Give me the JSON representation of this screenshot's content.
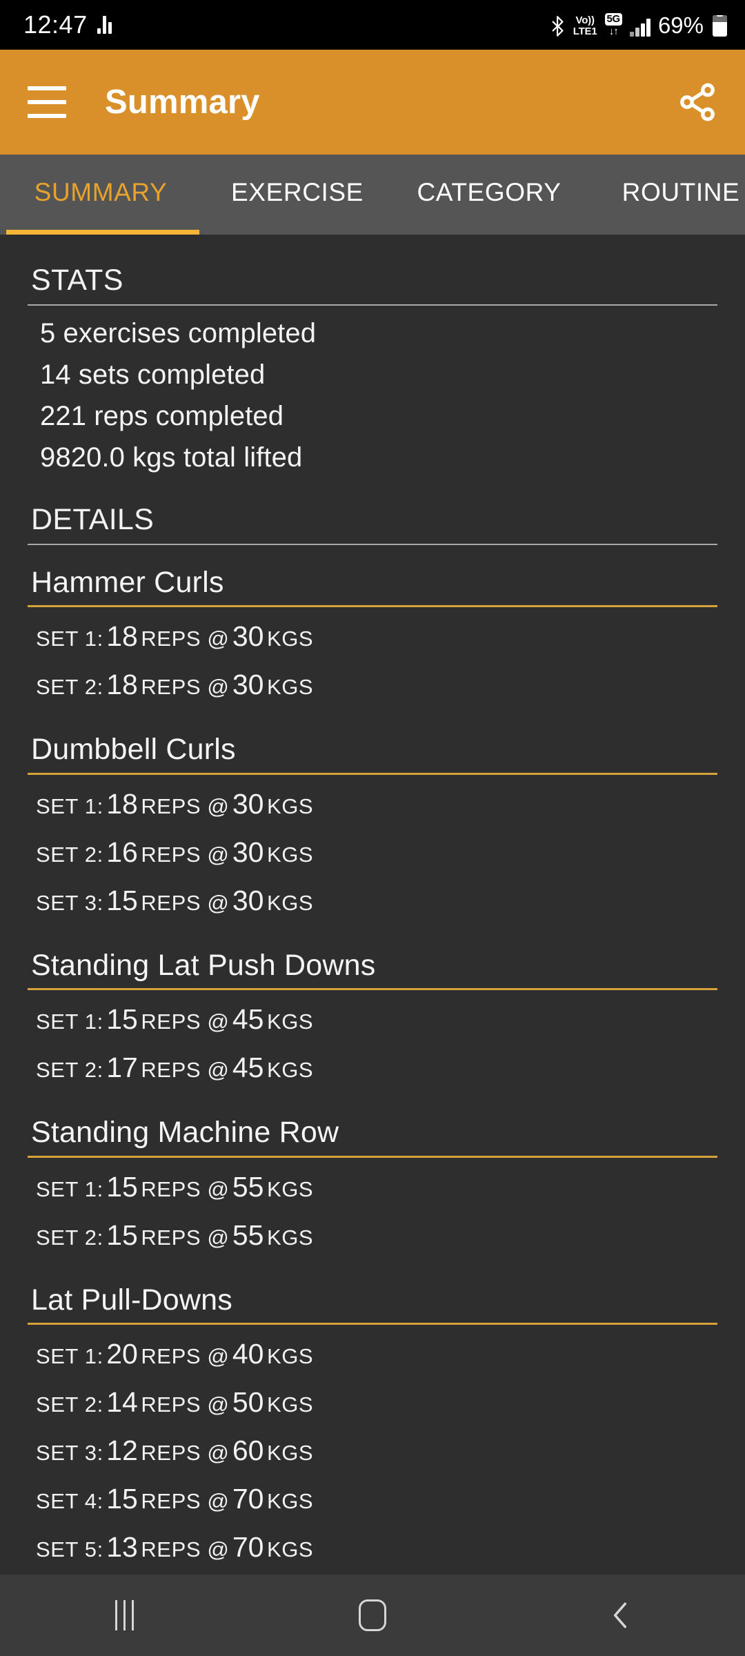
{
  "status_bar": {
    "time": "12:47",
    "equalizer_icon": "equalizer-icon",
    "bluetooth_icon": "bluetooth-icon",
    "volte_line1": "Vo))",
    "volte_line2": "LTE1",
    "network_badge": "5G",
    "data_arrows": "↓↑",
    "signal_icon": "signal-bars-icon",
    "battery_percent": "69%",
    "battery_icon": "battery-icon"
  },
  "app_bar": {
    "menu_icon": "hamburger-menu-icon",
    "title": "Summary",
    "share_icon": "share-icon",
    "background_color": "#d9902a"
  },
  "tabs": {
    "items": [
      {
        "label": "SUMMARY",
        "active": true
      },
      {
        "label": "EXERCISE",
        "active": false
      },
      {
        "label": "CATEGORY",
        "active": false
      },
      {
        "label": "ROUTINE",
        "active": false
      }
    ],
    "indicator_color": "#f7b538",
    "active_text_color": "#e8a32c"
  },
  "stats": {
    "heading": "STATS",
    "lines": [
      "5 exercises completed",
      "14 sets completed",
      "221 reps completed",
      "9820.0 kgs total lifted"
    ]
  },
  "details": {
    "heading": "DETAILS",
    "rule_color": "#d9a33c",
    "exercises": [
      {
        "name": "Hammer Curls",
        "sets": [
          {
            "label": "SET 1:",
            "reps": "18",
            "reps_unit": "REPS @",
            "weight": "30",
            "weight_unit": "KGS"
          },
          {
            "label": "SET 2:",
            "reps": "18",
            "reps_unit": "REPS @",
            "weight": "30",
            "weight_unit": "KGS"
          }
        ]
      },
      {
        "name": "Dumbbell Curls",
        "sets": [
          {
            "label": "SET 1:",
            "reps": "18",
            "reps_unit": "REPS @",
            "weight": "30",
            "weight_unit": "KGS"
          },
          {
            "label": "SET 2:",
            "reps": "16",
            "reps_unit": "REPS @",
            "weight": "30",
            "weight_unit": "KGS"
          },
          {
            "label": "SET 3:",
            "reps": "15",
            "reps_unit": "REPS @",
            "weight": "30",
            "weight_unit": "KGS"
          }
        ]
      },
      {
        "name": "Standing Lat Push Downs",
        "sets": [
          {
            "label": "SET 1:",
            "reps": "15",
            "reps_unit": "REPS @",
            "weight": "45",
            "weight_unit": "KGS"
          },
          {
            "label": "SET 2:",
            "reps": "17",
            "reps_unit": "REPS @",
            "weight": "45",
            "weight_unit": "KGS"
          }
        ]
      },
      {
        "name": "Standing Machine Row",
        "sets": [
          {
            "label": "SET 1:",
            "reps": "15",
            "reps_unit": "REPS @",
            "weight": "55",
            "weight_unit": "KGS"
          },
          {
            "label": "SET 2:",
            "reps": "15",
            "reps_unit": "REPS @",
            "weight": "55",
            "weight_unit": "KGS"
          }
        ]
      },
      {
        "name": "Lat Pull-Downs",
        "sets": [
          {
            "label": "SET 1:",
            "reps": "20",
            "reps_unit": "REPS @",
            "weight": "40",
            "weight_unit": "KGS"
          },
          {
            "label": "SET 2:",
            "reps": "14",
            "reps_unit": "REPS @",
            "weight": "50",
            "weight_unit": "KGS"
          },
          {
            "label": "SET 3:",
            "reps": "12",
            "reps_unit": "REPS @",
            "weight": "60",
            "weight_unit": "KGS"
          },
          {
            "label": "SET 4:",
            "reps": "15",
            "reps_unit": "REPS @",
            "weight": "70",
            "weight_unit": "KGS"
          },
          {
            "label": "SET 5:",
            "reps": "13",
            "reps_unit": "REPS @",
            "weight": "70",
            "weight_unit": "KGS"
          }
        ]
      }
    ]
  },
  "nav_bar": {
    "recents_icon": "recents-icon",
    "home_icon": "home-icon",
    "back_icon": "back-icon"
  }
}
